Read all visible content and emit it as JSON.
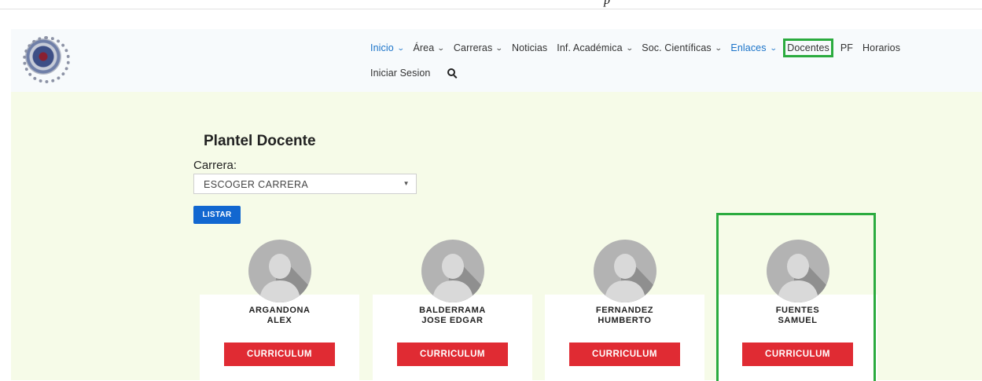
{
  "top_fragment": "p",
  "nav": {
    "row1": [
      {
        "label": "Inicio",
        "dropdown": true,
        "color": "blue"
      },
      {
        "label": "Área",
        "dropdown": true,
        "color": "dark"
      },
      {
        "label": "Carreras",
        "dropdown": true,
        "color": "dark"
      },
      {
        "label": "Noticias",
        "dropdown": false,
        "color": "dark"
      },
      {
        "label": "Inf. Académica",
        "dropdown": true,
        "color": "dark"
      },
      {
        "label": "Soc. Científicas",
        "dropdown": true,
        "color": "dark"
      },
      {
        "label": "Enlaces",
        "dropdown": true,
        "color": "blue"
      },
      {
        "label": "Docentes",
        "dropdown": false,
        "color": "dark",
        "highlighted": true
      },
      {
        "label": "PF",
        "dropdown": false,
        "color": "dark"
      },
      {
        "label": "Horarios",
        "dropdown": false,
        "color": "dark"
      }
    ],
    "login_label": "Iniciar Sesion",
    "search_icon": "search-icon"
  },
  "main": {
    "title": "Plantel Docente",
    "career_label": "Carrera:",
    "career_select_value": "ESCOGER CARRERA",
    "list_button": "LISTAR"
  },
  "teachers": [
    {
      "last": "ARGANDONA",
      "first": "ALEX",
      "cv": "CURRICULUM"
    },
    {
      "last": "BALDERRAMA",
      "first": "JOSE EDGAR",
      "cv": "CURRICULUM"
    },
    {
      "last": "FERNANDEZ",
      "first": "HUMBERTO",
      "cv": "CURRICULUM"
    },
    {
      "last": "FUENTES",
      "first": "SAMUEL",
      "cv": "CURRICULUM"
    }
  ],
  "colors": {
    "accent_blue": "#1267d0",
    "cv_red": "#e02b33",
    "highlight_green": "#2bab3f",
    "main_bg": "#f6fbe8"
  }
}
